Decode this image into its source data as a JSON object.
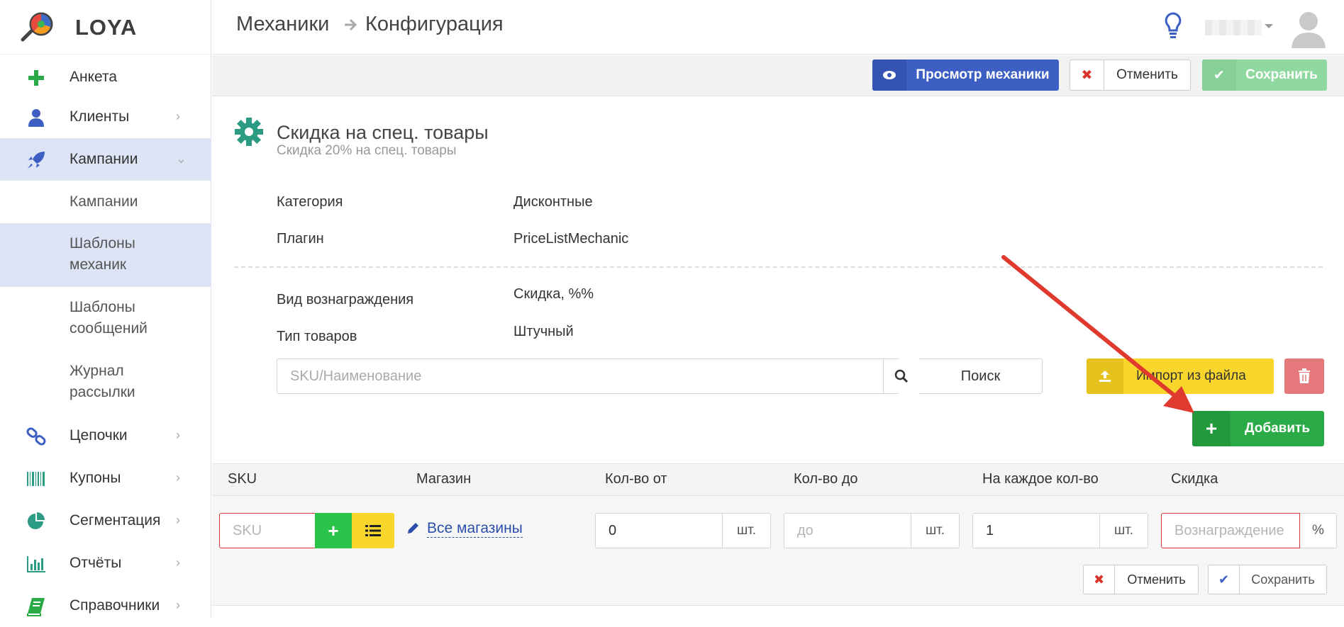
{
  "app": {
    "logo_text": "LOYA"
  },
  "header": {
    "breadcrumb": [
      "Механики",
      "Конфигурация"
    ]
  },
  "sidebar": {
    "items": [
      {
        "label": "Анкета",
        "icon": "plus-icon"
      },
      {
        "label": "Клиенты",
        "icon": "user-icon"
      },
      {
        "label": "Кампании",
        "icon": "rocket-icon",
        "active": true
      },
      {
        "label": "Цепочки",
        "icon": "chain-icon"
      },
      {
        "label": "Купоны",
        "icon": "barcode-icon"
      },
      {
        "label": "Сегментация",
        "icon": "pie-chart-icon"
      },
      {
        "label": "Отчёты",
        "icon": "bar-chart-icon"
      },
      {
        "label": "Справочники",
        "icon": "book-icon"
      }
    ],
    "subitems": [
      {
        "label": "Кампании"
      },
      {
        "label": "Шаблоны механик",
        "active": true
      },
      {
        "label": "Шаблоны сообщений"
      },
      {
        "label": "Журнал рассылки"
      }
    ]
  },
  "toolbar": {
    "view_label": "Просмотр механики",
    "cancel_label": "Отменить",
    "save_label": "Сохранить"
  },
  "mechanic": {
    "title": "Скидка на спец. товары",
    "subtitle": "Скидка 20% на спец. товары",
    "fields": [
      {
        "label": "Категория",
        "value": "Дисконтные"
      },
      {
        "label": "Плагин",
        "value": "PriceListMechanic"
      },
      {
        "label": "Вид вознаграждения",
        "value": "Скидка, %%"
      },
      {
        "label": "Тип товаров",
        "value": "Штучный"
      }
    ]
  },
  "search": {
    "placeholder": "SKU/Наименование",
    "button_label": "Поиск",
    "import_label": "Импорт из файла",
    "add_label": "Добавить"
  },
  "table": {
    "columns": [
      "SKU",
      "Магазин",
      "Кол-во от",
      "Кол-во до",
      "На каждое кол-во",
      "Скидка"
    ],
    "new_row": {
      "sku_placeholder": "SKU",
      "shops_link": "Все магазины",
      "qty_from_value": "0",
      "qty_to_placeholder": "до",
      "qty_each_value": "1",
      "unit": "шт.",
      "reward_placeholder": "Вознаграждение",
      "reward_unit": "%",
      "cancel_label": "Отменить",
      "save_label": "Сохранить"
    }
  },
  "colors": {
    "primary": "#3d5fc4",
    "success": "#2bab47",
    "warning": "#f8d62b",
    "danger": "#e4787a",
    "active_nav": "#dde4f5",
    "annotation_arrow": "#e03a2f"
  }
}
